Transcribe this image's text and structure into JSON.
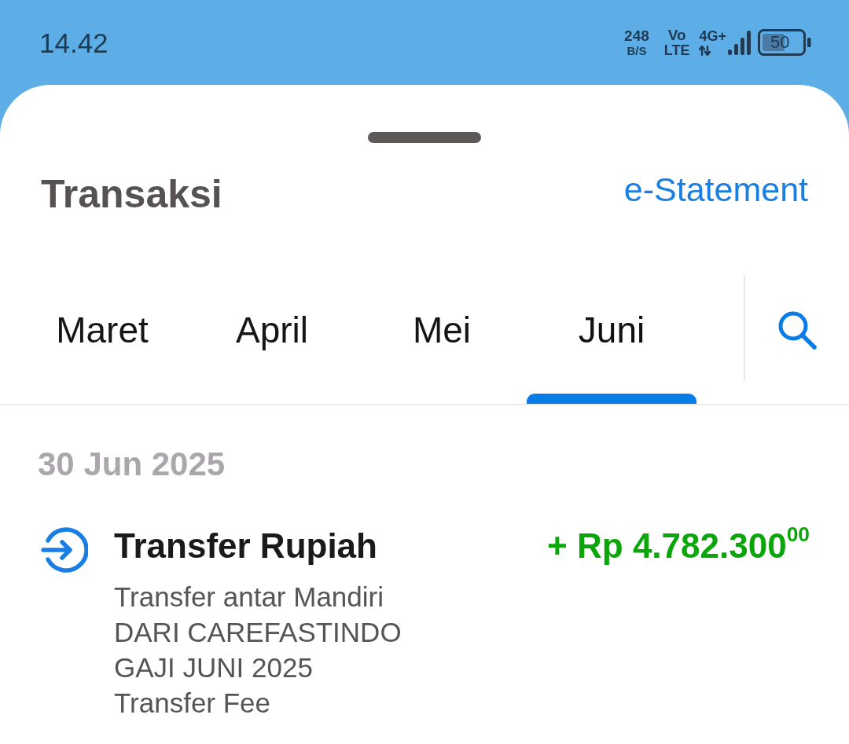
{
  "status_bar": {
    "time": "14.42",
    "data_speed": {
      "value": "248",
      "unit": "B/S"
    },
    "volte": {
      "top": "Vo",
      "bottom": "LTE"
    },
    "network": "4G+",
    "battery": "50"
  },
  "header": {
    "title": "Transaksi",
    "action": "e-Statement"
  },
  "month_tabs": [
    {
      "label": "Maret",
      "selected": false
    },
    {
      "label": "April",
      "selected": false
    },
    {
      "label": "Mei",
      "selected": false
    },
    {
      "label": "Juni",
      "selected": true
    }
  ],
  "transaction_groups": [
    {
      "date": "30 Jun 2025",
      "transactions": [
        {
          "kind": "credit",
          "title": "Transfer Rupiah",
          "amount": "+ Rp 4.782.300$^{00}$",
          "details": [
            "Transfer antar Mandiri",
            "DARI CAREFASTINDO",
            "GAJI JUNI 2025",
            "Transfer Fee"
          ]
        }
      ]
    }
  ]
}
